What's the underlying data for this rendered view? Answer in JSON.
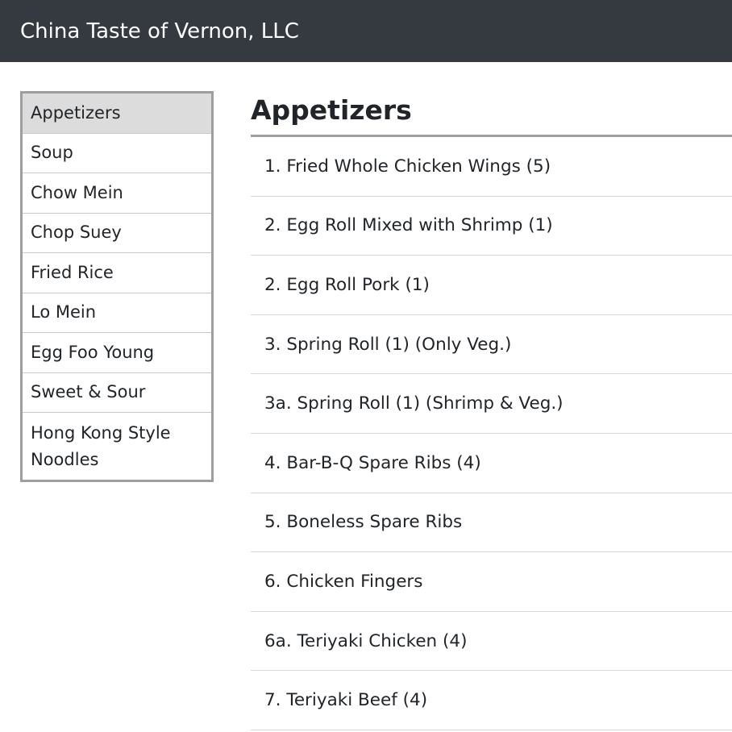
{
  "header": {
    "title": "China Taste of Vernon, LLC"
  },
  "sidebar": {
    "items": [
      {
        "label": "Appetizers",
        "active": true
      },
      {
        "label": "Soup"
      },
      {
        "label": "Chow Mein"
      },
      {
        "label": "Chop Suey"
      },
      {
        "label": "Fried Rice"
      },
      {
        "label": "Lo Mein"
      },
      {
        "label": "Egg Foo Young"
      },
      {
        "label": "Sweet & Sour"
      },
      {
        "label": "Hong Kong Style Noodles"
      }
    ]
  },
  "main": {
    "heading": "Appetizers",
    "items": [
      {
        "label": "1. Fried Whole Chicken Wings (5)"
      },
      {
        "label": "2. Egg Roll Mixed with Shrimp (1)"
      },
      {
        "label": "2. Egg Roll Pork (1)"
      },
      {
        "label": "3. Spring Roll (1) (Only Veg.)"
      },
      {
        "label": "3a. Spring Roll (1) (Shrimp & Veg.)"
      },
      {
        "label": "4. Bar-B-Q Spare Ribs (4)"
      },
      {
        "label": "5. Boneless Spare Ribs"
      },
      {
        "label": "6. Chicken Fingers"
      },
      {
        "label": "6a. Teriyaki Chicken (4)"
      },
      {
        "label": "7. Teriyaki Beef (4)"
      }
    ]
  },
  "colors": {
    "navbar_bg": "#343a40",
    "active_item_bg": "#dcdcdc",
    "border": "#9e9e9e"
  }
}
